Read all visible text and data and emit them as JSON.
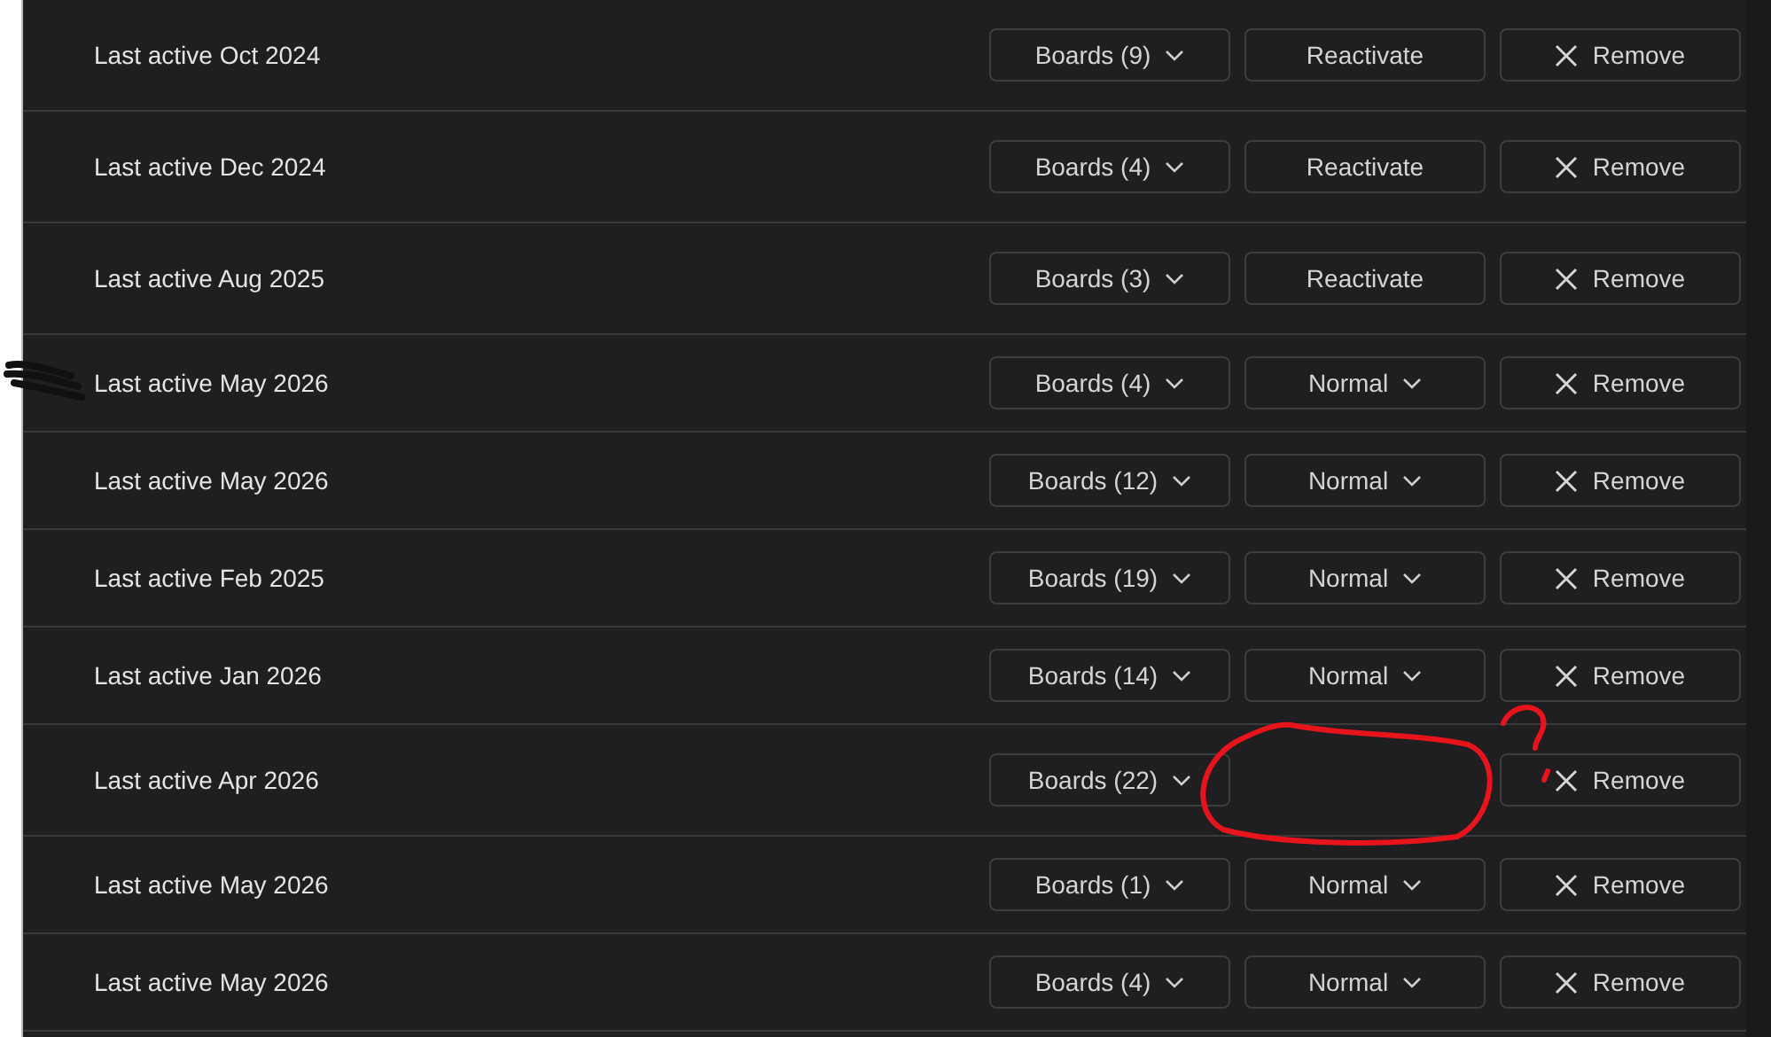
{
  "rows": [
    {
      "label": "Last active Oct 2024",
      "boards": "Boards (9)",
      "status": {
        "kind": "button",
        "label": "Reactivate"
      },
      "remove": "Remove"
    },
    {
      "label": "Last active Dec 2024",
      "boards": "Boards (4)",
      "status": {
        "kind": "button",
        "label": "Reactivate"
      },
      "remove": "Remove"
    },
    {
      "label": "Last active Aug 2025",
      "boards": "Boards (3)",
      "status": {
        "kind": "button",
        "label": "Reactivate"
      },
      "remove": "Remove"
    },
    {
      "label": "Last active May 2026",
      "boards": "Boards (4)",
      "status": {
        "kind": "dropdown",
        "label": "Normal"
      },
      "remove": "Remove"
    },
    {
      "label": "Last active May 2026",
      "boards": "Boards (12)",
      "status": {
        "kind": "dropdown",
        "label": "Normal"
      },
      "remove": "Remove"
    },
    {
      "label": "Last active Feb 2025",
      "boards": "Boards (19)",
      "status": {
        "kind": "dropdown",
        "label": "Normal"
      },
      "remove": "Remove"
    },
    {
      "label": "Last active Jan 2026",
      "boards": "Boards (14)",
      "status": {
        "kind": "dropdown",
        "label": "Normal"
      },
      "remove": "Remove"
    },
    {
      "label": "Last active Apr 2026",
      "boards": "Boards (22)",
      "status": {
        "kind": "empty"
      },
      "remove": "Remove"
    },
    {
      "label": "Last active May 2026",
      "boards": "Boards (1)",
      "status": {
        "kind": "dropdown",
        "label": "Normal"
      },
      "remove": "Remove"
    },
    {
      "label": "Last active May 2026",
      "boards": "Boards (4)",
      "status": {
        "kind": "dropdown",
        "label": "Normal"
      },
      "remove": "Remove"
    }
  ]
}
